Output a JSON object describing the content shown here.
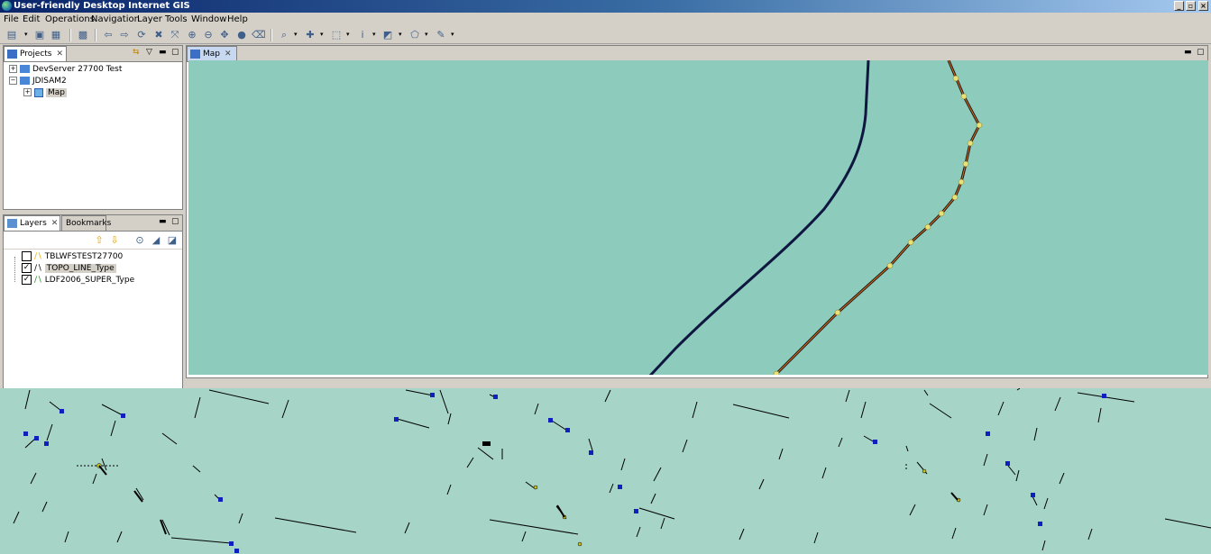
{
  "window": {
    "title": "User-friendly Desktop Internet GIS"
  },
  "menu": [
    "File",
    "Edit",
    "Operations",
    "Navigation",
    "Layer",
    "Tools",
    "Window",
    "Help"
  ],
  "toolbar_icons": [
    "new-icon",
    "save-icon",
    "save-all-icon",
    "print-icon",
    "back-icon",
    "forward-icon",
    "refresh-icon",
    "stop-icon",
    "zoom-full-icon",
    "zoom-in-icon",
    "zoom-out-icon",
    "pan-icon",
    "record-icon",
    "eraser-icon",
    "magnify-icon",
    "move-icon",
    "select-box-icon",
    "info-icon",
    "layer-style-icon",
    "edit-geometry-icon",
    "tool-icon"
  ],
  "projects": {
    "tab_label": "Projects",
    "items": [
      {
        "label": "DevServer 27700 Test",
        "level": 0,
        "expanded": false
      },
      {
        "label": "JDISAM2",
        "level": 0,
        "expanded": true
      },
      {
        "label": "Map",
        "level": 1,
        "expanded": false,
        "selected": true
      }
    ]
  },
  "layers": {
    "tab_label": "Layers",
    "bookmarks_label": "Bookmarks",
    "items": [
      {
        "label": "TBLWFSTEST27700",
        "checked": false
      },
      {
        "label": "TOPO_LINE_Type",
        "checked": true,
        "selected": true
      },
      {
        "label": "LDF2006_SUPER_Type",
        "checked": true
      }
    ]
  },
  "map": {
    "tab_label": "Map",
    "background": "#8dcbbd"
  },
  "colors": {
    "title_start": "#0a246a",
    "title_end": "#a6caf0",
    "line_dark": "#0f1740",
    "line_vertex": "#e8e07a",
    "point_blue": "#1020c0"
  }
}
